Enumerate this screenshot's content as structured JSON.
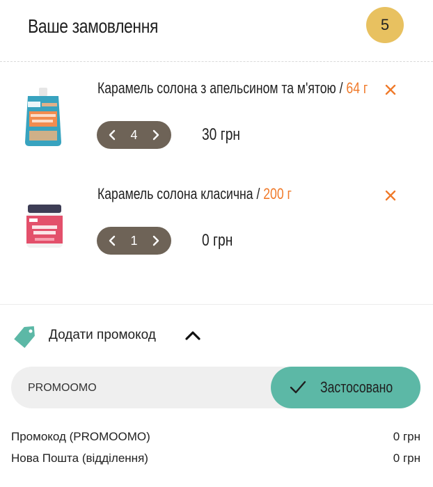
{
  "header": {
    "title": "Ваше замовлення",
    "count": "5"
  },
  "items": [
    {
      "name": "Карамель солона з апельсином та м'ятою / ",
      "weight": "64 г",
      "qty": "4",
      "price": "30 грн",
      "image_icon": "pouch-product-icon"
    },
    {
      "name": "Карамель солона класична / ",
      "weight": "200 г",
      "qty": "1",
      "price": "0 грн",
      "image_icon": "jar-product-icon"
    }
  ],
  "promo": {
    "toggle_label": "Додати промокод",
    "code_value": "PROMOOMO",
    "apply_label": "Застосовано"
  },
  "summary": [
    {
      "label": "Промокод (PROMOOMO)",
      "value": "0 грн"
    },
    {
      "label": "Нова Пошта (відділення)",
      "value": "0 грн"
    }
  ],
  "colors": {
    "accent_orange": "#f07a2a",
    "badge_gold": "#e8c160",
    "stepper_brown": "#6e6357",
    "apply_teal": "#5cb8a6"
  }
}
